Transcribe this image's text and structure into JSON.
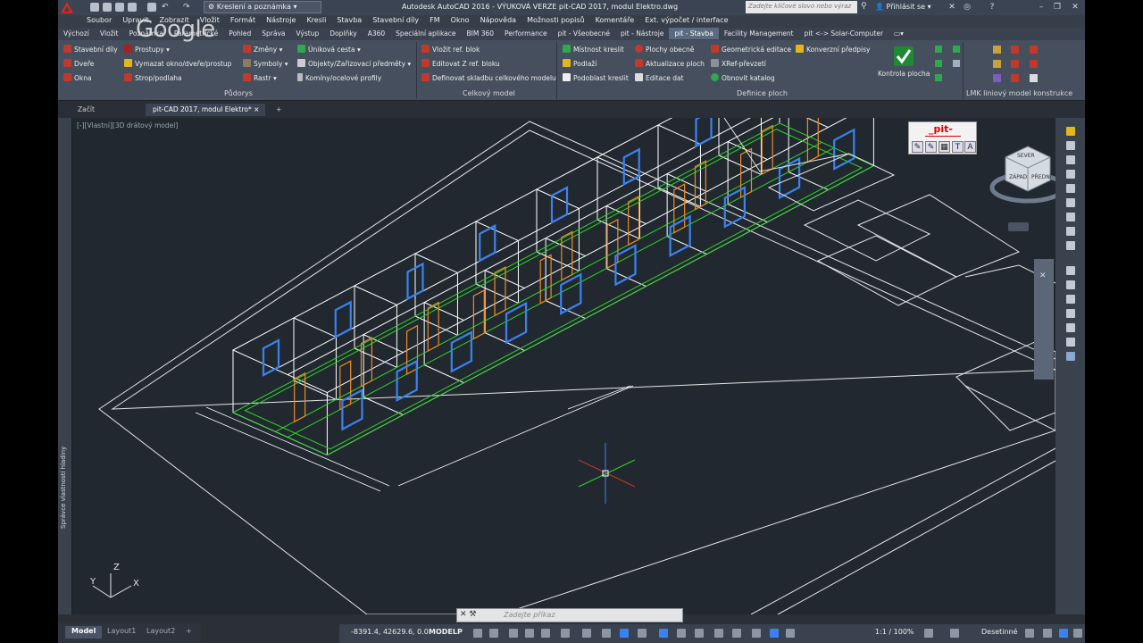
{
  "app": {
    "title": "Autodesk AutoCAD 2016 - VÝUKOVÁ VERZE    pit-CAD 2017, modul Elektro.dwg",
    "workspace": "Kreslení a poznámka",
    "search_placeholder": "Zadejte klíčové slovo nebo výraz",
    "login": "Přihlásit se"
  },
  "menubar": [
    "Soubor",
    "Upravit",
    "Zobrazit",
    "Vložit",
    "Formát",
    "Nástroje",
    "Kresli",
    "Stavba",
    "Stavební díly",
    "FM",
    "Okno",
    "Nápověda",
    "Možnosti popisů",
    "Komentáře",
    "Ext. výpočet / interface"
  ],
  "ribbon_tabs": {
    "items": [
      "Výchozí",
      "Vložit",
      "Poznámka",
      "Parametrické",
      "Pohled",
      "Správa",
      "Výstup",
      "Doplňky",
      "A360",
      "Speciální aplikace",
      "BIM 360",
      "Performance",
      "pit - Všeobecné",
      "pit - Nástroje",
      "pit - Stavba",
      "Facility Management",
      "pit <-> Solar-Computer"
    ],
    "active": "pit - Stavba"
  },
  "ribbon": {
    "pudorys": {
      "title": "Půdorys",
      "col1": [
        "Stavební díly",
        "Dveře",
        "Okna"
      ],
      "col2": [
        "Prostupy",
        "Vymazat okno/dveře/prostup",
        "Strop/podlaha"
      ],
      "col3": [
        "Změny",
        "Symboly",
        "Rastr"
      ],
      "col4": [
        "Úniková cesta",
        "Objekty/Zařizovací předměty",
        "Komíny/ocelové profily"
      ]
    },
    "celkovy": {
      "title": "Celkový model",
      "items": [
        "Vložit ref. blok",
        "Editovat Z ref. bloku",
        "Definovat skladbu celkového modelu"
      ]
    },
    "definice": {
      "title": "Definice ploch",
      "col1": [
        "Místnost kreslit",
        "Podlaží",
        "Podoblast kreslit"
      ],
      "col2": [
        "Plochy obecně",
        "Aktualizace ploch",
        "Editace dat"
      ],
      "col3": [
        "Geometrická editace",
        "XRef-převzetí",
        "Obnovit katalog"
      ],
      "col4": [
        "Konverzní  předpisy"
      ],
      "big": "Kontrola plocha"
    },
    "lmk": {
      "title": "LMK liniový model konstrukce"
    }
  },
  "doc_tabs": [
    "Začít",
    "pit-CAD 2017, modul Elektro*"
  ],
  "viewport_label": "[-][Vlastní][3D drátový model]",
  "palette_title": "Správce vlastností hladiny",
  "layout_tabs": [
    "Model",
    "Layout1",
    "Layout2"
  ],
  "command_placeholder": "Zadejte příkaz",
  "status": {
    "coords": "-8391.4, 42629.6, 0.0",
    "mode": "MODELP",
    "scale": "1:1 / 100%",
    "units": "Desetinné"
  },
  "nav": {
    "pit_logo": "_pit-",
    "viewcube_labels": [
      "SEVER",
      "PŘEDNÍ",
      "ZÁPAD"
    ],
    "ucs_labels": [
      "Y",
      "Z",
      "X"
    ]
  },
  "watermark": "Google",
  "colors": {
    "drawing_bg": "#212830",
    "walls": "#ffffff",
    "windows": "#3b82f0",
    "doors": "#f08a24",
    "floor_edges": "#32d22a"
  }
}
